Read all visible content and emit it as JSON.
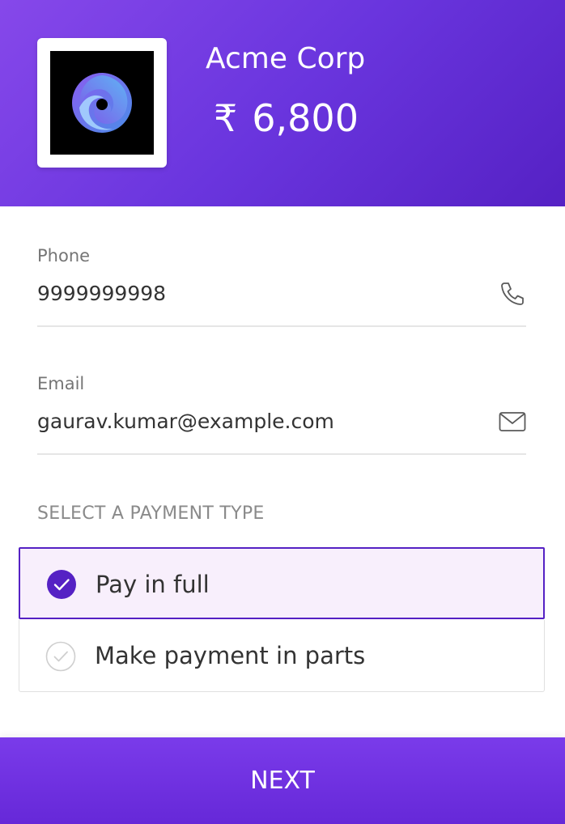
{
  "header": {
    "merchant_name": "Acme Corp",
    "currency_symbol": "₹",
    "amount": "6,800",
    "logo_icon": "spiral-logo"
  },
  "form": {
    "phone": {
      "label": "Phone",
      "value": "9999999998",
      "icon": "phone-icon"
    },
    "email": {
      "label": "Email",
      "value": "gaurav.kumar@example.com",
      "icon": "mail-icon"
    }
  },
  "payment_type": {
    "title": "SELECT A PAYMENT TYPE",
    "options": [
      {
        "label": "Pay in full",
        "selected": true
      },
      {
        "label": "Make payment in parts",
        "selected": false
      }
    ]
  },
  "footer": {
    "next_label": "NEXT"
  },
  "colors": {
    "primary": "#5521c4",
    "header_start": "#8648ea",
    "selected_bg": "#f8effc",
    "button": "#6e30e0"
  }
}
